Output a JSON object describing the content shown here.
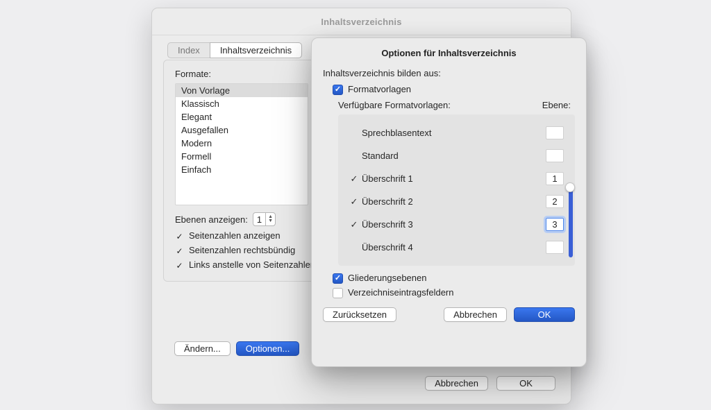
{
  "window": {
    "title": "Inhaltsverzeichnis",
    "tabs": {
      "index": "Index",
      "toc": "Inhaltsverzeichnis"
    },
    "formats_label": "Formate:",
    "formats": [
      "Von Vorlage",
      "Klassisch",
      "Elegant",
      "Ausgefallen",
      "Modern",
      "Formell",
      "Einfach"
    ],
    "levels_label": "Ebenen anzeigen:",
    "levels_value": "1",
    "options": {
      "show_pages": "Seitenzahlen anzeigen",
      "right_align": "Seitenzahlen rechtsbündig",
      "links_instead": "Links anstelle von Seitenzahlen"
    },
    "buttons": {
      "modify": "Ändern...",
      "options": "Optionen..."
    },
    "footer": {
      "cancel": "Abbrechen",
      "ok": "OK"
    }
  },
  "sheet": {
    "title": "Optionen für Inhaltsverzeichnis",
    "build_from_label": "Inhaltsverzeichnis bilden aus:",
    "styles_checkbox": "Formatvorlagen",
    "available_label": "Verfügbare Formatvorlagen:",
    "level_label": "Ebene:",
    "styles": [
      {
        "name": "Sprechblasentext",
        "level": "",
        "checked": false
      },
      {
        "name": "Standard",
        "level": "",
        "checked": false
      },
      {
        "name": "Überschrift 1",
        "level": "1",
        "checked": true
      },
      {
        "name": "Überschrift 2",
        "level": "2",
        "checked": true
      },
      {
        "name": "Überschrift 3",
        "level": "3",
        "checked": true,
        "focused": true
      },
      {
        "name": "Überschrift 4",
        "level": "",
        "checked": false
      }
    ],
    "outline_checkbox": "Gliederungsebenen",
    "entry_fields_checkbox": "Verzeichniseintragsfeldern",
    "buttons": {
      "reset": "Zurücksetzen",
      "cancel": "Abbrechen",
      "ok": "OK"
    }
  }
}
